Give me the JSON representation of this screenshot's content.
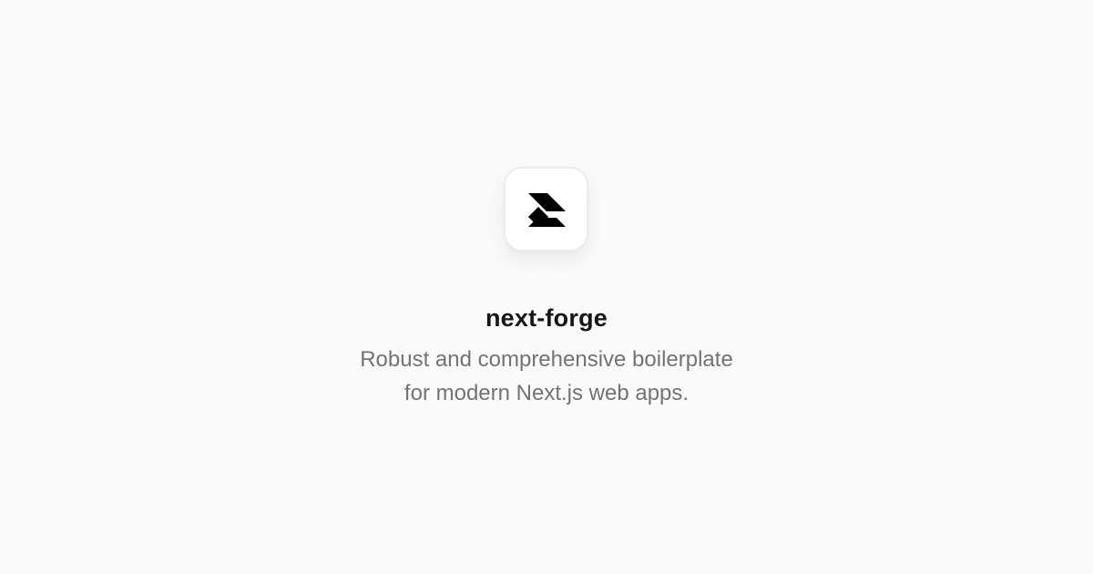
{
  "logo": {
    "icon": "next-forge-logo-icon",
    "color": "#000000"
  },
  "title": "next-forge",
  "description": {
    "line1": "Robust and comprehensive boilerplate",
    "line2": "for modern Next.js web apps."
  },
  "colors": {
    "background": "#fafafa",
    "title": "#171717",
    "description": "#737373"
  }
}
